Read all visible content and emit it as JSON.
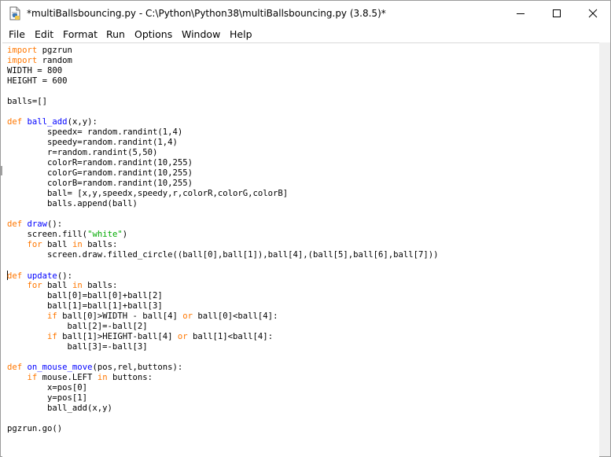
{
  "window": {
    "title": "*multiBallsbouncing.py - C:\\Python\\Python38\\multiBallsbouncing.py (3.8.5)*",
    "app_icon": "idle-file-icon",
    "controls": [
      "minimize-icon",
      "maximize-icon",
      "close-icon"
    ]
  },
  "menu": {
    "items": [
      "File",
      "Edit",
      "Format",
      "Run",
      "Options",
      "Window",
      "Help"
    ]
  },
  "editor": {
    "colors": {
      "keyword": "#ff7700",
      "definition": "#0000ff",
      "string": "#00aa00",
      "text": "#000000"
    },
    "lines": [
      [
        [
          "k",
          "import"
        ],
        [
          "p",
          " pgzrun"
        ]
      ],
      [
        [
          "k",
          "import"
        ],
        [
          "p",
          " random"
        ]
      ],
      [
        [
          "p",
          "WIDTH = 800"
        ]
      ],
      [
        [
          "p",
          "HEIGHT = 600"
        ]
      ],
      [
        [
          "p",
          ""
        ]
      ],
      [
        [
          "p",
          "balls=[]"
        ]
      ],
      [
        [
          "p",
          ""
        ]
      ],
      [
        [
          "k",
          "def"
        ],
        [
          "p",
          " "
        ],
        [
          "f",
          "ball_add"
        ],
        [
          "p",
          "(x,y):"
        ]
      ],
      [
        [
          "p",
          "        speedx= random.randint(1,4)"
        ]
      ],
      [
        [
          "p",
          "        speedy=random.randint(1,4)"
        ]
      ],
      [
        [
          "p",
          "        r=random.randint(5,50)"
        ]
      ],
      [
        [
          "p",
          "        colorR=random.randint(10,255)"
        ]
      ],
      [
        [
          "p",
          "        colorG=random.randint(10,255)"
        ]
      ],
      [
        [
          "p",
          "        colorB=random.randint(10,255)"
        ]
      ],
      [
        [
          "p",
          "        ball= [x,y,speedx,speedy,r,colorR,colorG,colorB]"
        ]
      ],
      [
        [
          "p",
          "        balls.append(ball)"
        ]
      ],
      [
        [
          "p",
          ""
        ]
      ],
      [
        [
          "k",
          "def"
        ],
        [
          "p",
          " "
        ],
        [
          "f",
          "draw"
        ],
        [
          "p",
          "():"
        ]
      ],
      [
        [
          "p",
          "    screen.fill("
        ],
        [
          "s",
          "\"white\""
        ],
        [
          "p",
          ")"
        ]
      ],
      [
        [
          "p",
          "    "
        ],
        [
          "k",
          "for"
        ],
        [
          "p",
          " ball "
        ],
        [
          "k",
          "in"
        ],
        [
          "p",
          " balls:"
        ]
      ],
      [
        [
          "p",
          "        screen.draw.filled_circle((ball[0],ball[1]),ball[4],(ball[5],ball[6],ball[7]))"
        ]
      ],
      [
        [
          "p",
          ""
        ]
      ],
      [
        [
          "c",
          ""
        ],
        [
          "k",
          "def"
        ],
        [
          "p",
          " "
        ],
        [
          "f",
          "update"
        ],
        [
          "p",
          "():"
        ]
      ],
      [
        [
          "p",
          "    "
        ],
        [
          "k",
          "for"
        ],
        [
          "p",
          " ball "
        ],
        [
          "k",
          "in"
        ],
        [
          "p",
          " balls:"
        ]
      ],
      [
        [
          "p",
          "        ball[0]=ball[0]+ball[2]"
        ]
      ],
      [
        [
          "p",
          "        ball[1]=ball[1]+ball[3]"
        ]
      ],
      [
        [
          "p",
          "        "
        ],
        [
          "k",
          "if"
        ],
        [
          "p",
          " ball[0]>WIDTH - ball[4] "
        ],
        [
          "k",
          "or"
        ],
        [
          "p",
          " ball[0]<ball[4]:"
        ]
      ],
      [
        [
          "p",
          "            ball[2]=-ball[2]"
        ]
      ],
      [
        [
          "p",
          "        "
        ],
        [
          "k",
          "if"
        ],
        [
          "p",
          " ball[1]>HEIGHT-ball[4] "
        ],
        [
          "k",
          "or"
        ],
        [
          "p",
          " ball[1]<ball[4]:"
        ]
      ],
      [
        [
          "p",
          "            ball[3]=-ball[3]"
        ]
      ],
      [
        [
          "p",
          ""
        ]
      ],
      [
        [
          "k",
          "def"
        ],
        [
          "p",
          " "
        ],
        [
          "f",
          "on_mouse_move"
        ],
        [
          "p",
          "(pos,rel,buttons):"
        ]
      ],
      [
        [
          "p",
          "    "
        ],
        [
          "k",
          "if"
        ],
        [
          "p",
          " mouse.LEFT "
        ],
        [
          "k",
          "in"
        ],
        [
          "p",
          " buttons:"
        ]
      ],
      [
        [
          "p",
          "        x=pos[0]"
        ]
      ],
      [
        [
          "p",
          "        y=pos[1]"
        ]
      ],
      [
        [
          "p",
          "        ball_add(x,y)"
        ]
      ],
      [
        [
          "p",
          ""
        ]
      ],
      [
        [
          "p",
          "pgzrun.go()"
        ]
      ]
    ]
  }
}
